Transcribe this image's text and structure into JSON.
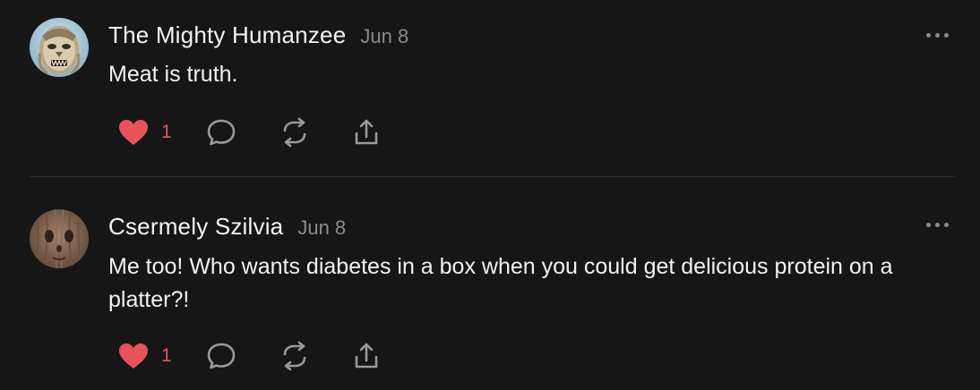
{
  "comments": [
    {
      "author": "The Mighty Humanzee",
      "date": "Jun 8",
      "text": "Meat is truth.",
      "likes": "1",
      "avatar_icon": "primate-face-avatar"
    },
    {
      "author": "Csermely Szilvia",
      "date": "Jun 8",
      "text": "Me too! Who wants diabetes in a box when you could get delicious protein on a platter?!",
      "likes": "1",
      "avatar_icon": "wood-face-avatar"
    }
  ],
  "colors": {
    "background": "#161616",
    "like_red": "#e8525a",
    "muted": "#8a8a8a",
    "text": "#f2f2f2"
  }
}
